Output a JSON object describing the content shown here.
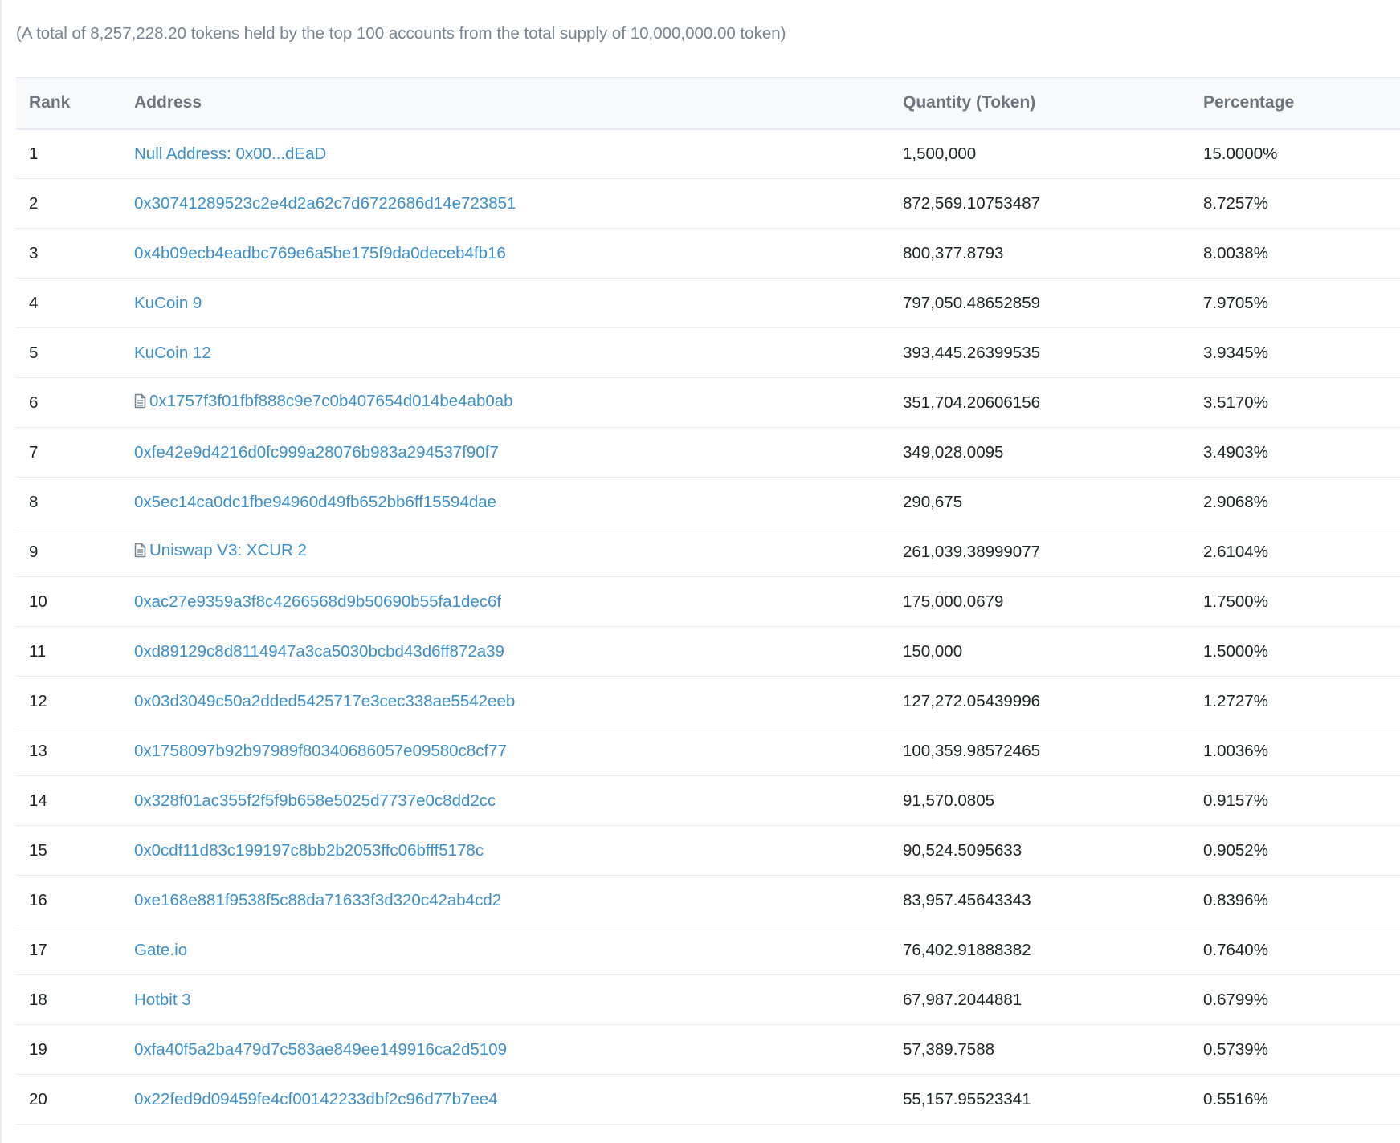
{
  "summary_text": "(A total of 8,257,228.20 tokens held by the top 100 accounts from the total supply of 10,000,000.00 token)",
  "table": {
    "headers": {
      "rank": "Rank",
      "address": "Address",
      "quantity": "Quantity (Token)",
      "percentage": "Percentage"
    },
    "rows": [
      {
        "rank": "1",
        "address": "Null Address: 0x00...dEaD",
        "contract": false,
        "quantity": "1,500,000",
        "percentage": "15.0000%"
      },
      {
        "rank": "2",
        "address": "0x30741289523c2e4d2a62c7d6722686d14e723851",
        "contract": false,
        "quantity": "872,569.10753487",
        "percentage": "8.7257%"
      },
      {
        "rank": "3",
        "address": "0x4b09ecb4eadbc769e6a5be175f9da0deceb4fb16",
        "contract": false,
        "quantity": "800,377.8793",
        "percentage": "8.0038%"
      },
      {
        "rank": "4",
        "address": "KuCoin 9",
        "contract": false,
        "quantity": "797,050.48652859",
        "percentage": "7.9705%"
      },
      {
        "rank": "5",
        "address": "KuCoin 12",
        "contract": false,
        "quantity": "393,445.26399535",
        "percentage": "3.9345%"
      },
      {
        "rank": "6",
        "address": "0x1757f3f01fbf888c9e7c0b407654d014be4ab0ab",
        "contract": true,
        "quantity": "351,704.20606156",
        "percentage": "3.5170%"
      },
      {
        "rank": "7",
        "address": "0xfe42e9d4216d0fc999a28076b983a294537f90f7",
        "contract": false,
        "quantity": "349,028.0095",
        "percentage": "3.4903%"
      },
      {
        "rank": "8",
        "address": "0x5ec14ca0dc1fbe94960d49fb652bb6ff15594dae",
        "contract": false,
        "quantity": "290,675",
        "percentage": "2.9068%"
      },
      {
        "rank": "9",
        "address": "Uniswap V3: XCUR 2",
        "contract": true,
        "quantity": "261,039.38999077",
        "percentage": "2.6104%"
      },
      {
        "rank": "10",
        "address": "0xac27e9359a3f8c4266568d9b50690b55fa1dec6f",
        "contract": false,
        "quantity": "175,000.0679",
        "percentage": "1.7500%"
      },
      {
        "rank": "11",
        "address": "0xd89129c8d8114947a3ca5030bcbd43d6ff872a39",
        "contract": false,
        "quantity": "150,000",
        "percentage": "1.5000%"
      },
      {
        "rank": "12",
        "address": "0x03d3049c50a2dded5425717e3cec338ae5542eeb",
        "contract": false,
        "quantity": "127,272.05439996",
        "percentage": "1.2727%"
      },
      {
        "rank": "13",
        "address": "0x1758097b92b97989f80340686057e09580c8cf77",
        "contract": false,
        "quantity": "100,359.98572465",
        "percentage": "1.0036%"
      },
      {
        "rank": "14",
        "address": "0x328f01ac355f2f5f9b658e5025d7737e0c8dd2cc",
        "contract": false,
        "quantity": "91,570.0805",
        "percentage": "0.9157%"
      },
      {
        "rank": "15",
        "address": "0x0cdf11d83c199197c8bb2b2053ffc06bfff5178c",
        "contract": false,
        "quantity": "90,524.5095633",
        "percentage": "0.9052%"
      },
      {
        "rank": "16",
        "address": "0xe168e881f9538f5c88da71633f3d320c42ab4cd2",
        "contract": false,
        "quantity": "83,957.45643343",
        "percentage": "0.8396%"
      },
      {
        "rank": "17",
        "address": "Gate.io",
        "contract": false,
        "quantity": "76,402.91888382",
        "percentage": "0.7640%"
      },
      {
        "rank": "18",
        "address": "Hotbit 3",
        "contract": false,
        "quantity": "67,987.2044881",
        "percentage": "0.6799%"
      },
      {
        "rank": "19",
        "address": "0xfa40f5a2ba479d7c583ae849ee149916ca2d5109",
        "contract": false,
        "quantity": "57,389.7588",
        "percentage": "0.5739%"
      },
      {
        "rank": "20",
        "address": "0x22fed9d09459fe4cf00142233dbf2c96d77b7ee4",
        "contract": false,
        "quantity": "55,157.95523341",
        "percentage": "0.5516%"
      }
    ]
  },
  "colors": {
    "link": "#3a8fc8",
    "header_bg": "#f8f9fa",
    "border": "#e7eaf3",
    "muted_text": "#77838f"
  },
  "icons": {
    "contract": "contract-document-icon"
  }
}
